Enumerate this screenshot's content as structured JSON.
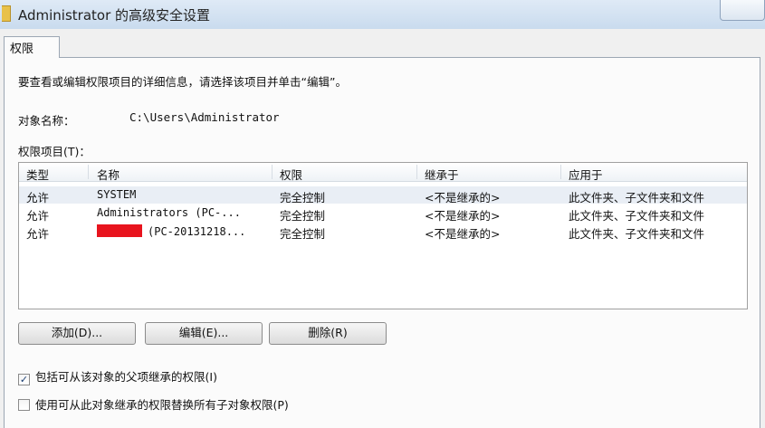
{
  "window": {
    "title": "Administrator 的高级安全设置"
  },
  "tabs": [
    {
      "label": "权限"
    }
  ],
  "instruction": "要查看或编辑权限项目的详细信息，请选择该项目并单击“编辑”。",
  "object": {
    "label": "对象名称：",
    "value": "C:\\Users\\Administrator"
  },
  "entries": {
    "label": "权限项目(T)：",
    "columns": [
      "类型",
      "名称",
      "权限",
      "继承于",
      "应用于"
    ],
    "rows": [
      {
        "type": "允许",
        "name": "SYSTEM",
        "permission": "完全控制",
        "inherited": "<不是继承的>",
        "applies": "此文件夹、子文件夹和文件"
      },
      {
        "type": "允许",
        "name": "Administrators (PC-...",
        "permission": "完全控制",
        "inherited": "<不是继承的>",
        "applies": "此文件夹、子文件夹和文件"
      },
      {
        "type": "允许",
        "name": "(PC-20131218...",
        "permission": "完全控制",
        "inherited": "<不是继承的>",
        "applies": "此文件夹、子文件夹和文件"
      }
    ]
  },
  "buttons": {
    "add": "添加(D)...",
    "edit": "编辑(E)...",
    "remove": "删除(R)"
  },
  "checkboxes": {
    "include_inheritable": {
      "label": "包括可从该对象的父项继承的权限(I)",
      "checked": true
    },
    "replace_child": {
      "label": "使用可从此对象继承的权限替换所有子对象权限(P)",
      "checked": false
    }
  },
  "colors": {
    "redaction": "#e8141e",
    "selected_row": "#e9eef5"
  }
}
